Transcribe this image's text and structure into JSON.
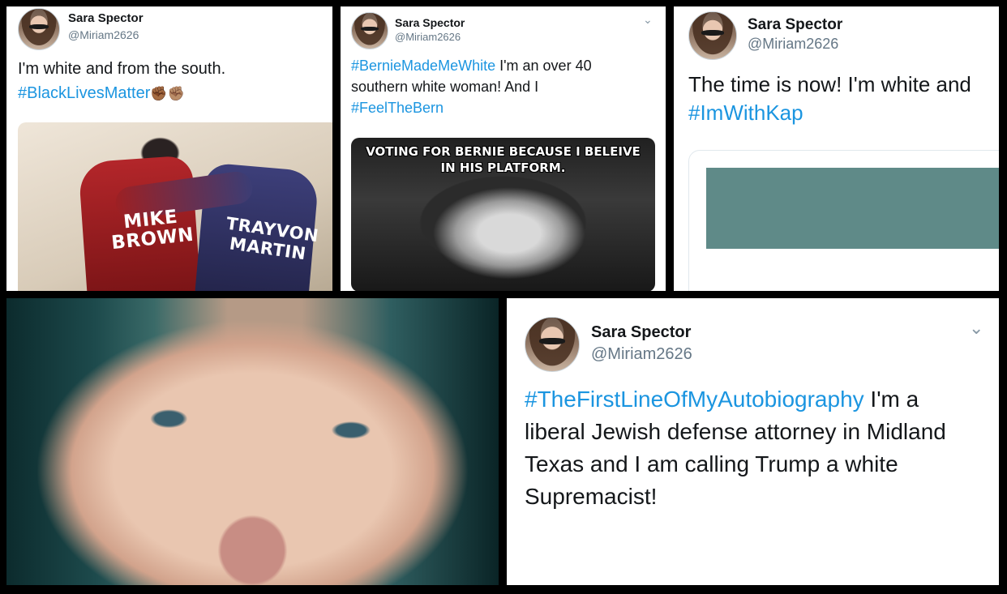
{
  "tweets": [
    {
      "name": "Sara Spector",
      "handle": "@Miriam2626",
      "text_plain_1": "I'm white and from the south.",
      "hashtag_1": "#BlackLivesMatter",
      "emoji": "✊🏾✊🏽"
    },
    {
      "name": "Sara Spector",
      "handle": "@Miriam2626",
      "hashtag_1": "#BernieMadeMeWhite",
      "text_after_1": " I'm an over 40",
      "text_line_2": "southern white woman! And I",
      "hashtag_2": "#FeelTheBern",
      "meme_caption": "VOTING FOR BERNIE BECAUSE I BELEIVE IN HIS PLATFORM."
    },
    {
      "name": "Sara Spector",
      "handle": "@Miriam2626",
      "text_plain_1": "The time is now! I'm white and",
      "hashtag_1": "#ImWithKap"
    },
    {
      "name": "Sara Spector",
      "handle": "@Miriam2626",
      "hashtag_1": "#TheFirstLineOfMyAutobiography",
      "text_after_1": " I'm a",
      "text_line_2": "liberal Jewish defense attorney in Midland",
      "text_line_3": "Texas and I am calling Trump a white",
      "text_line_4": "Supremacist!"
    }
  ],
  "hoodie": {
    "left_label": "MIKE BROWN",
    "right_label": "TRAYVON MARTIN"
  },
  "icons": {
    "chevron": "chevron-down-icon"
  },
  "colors": {
    "hashtag": "#1b95e0",
    "handle": "#657786",
    "card_fill": "#5f8a88"
  }
}
